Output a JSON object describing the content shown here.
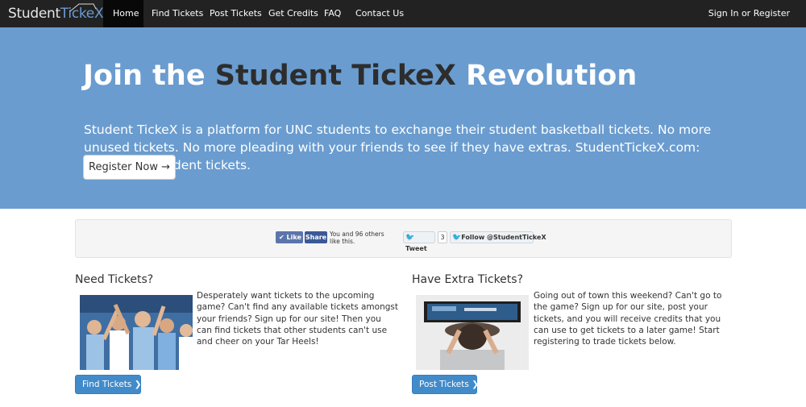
{
  "brand": {
    "part1": "Student",
    "part2": "TickeX"
  },
  "nav": {
    "home": "Home",
    "find": "Find Tickets",
    "post": "Post Tickets",
    "credits": "Get Credits",
    "faq": "FAQ",
    "contact": "Contact Us",
    "signin": "Sign In or Register"
  },
  "hero": {
    "title_part1": "Join the ",
    "title_part2": "Student TickeX",
    "title_part3": " Revolution",
    "description": "Student TickeX is a platform for UNC students to exchange their student basketball tickets. No more unused tickets. No more pleading with your friends to see if they have extras. StudentTickeX.com: Simplyfing student tickets.",
    "register_label": "Register Now →"
  },
  "social": {
    "like": "Like",
    "share": "Share",
    "like_count_text": "You and 96 others like this.",
    "tweet": "Tweet",
    "tweet_count": "3",
    "follow": "Follow @StudentTickeX"
  },
  "left": {
    "heading": "Need Tickets?",
    "text": "Desperately want tickets to the upcoming game? Can't find any available tickets amongst your friends? Sign up for our site! Then you can find tickets that other students can't use and cheer on your Tar Heels!",
    "button": "Find Tickets"
  },
  "right": {
    "heading": "Have Extra Tickets?",
    "text": "Going out of town this weekend? Can't go to the game? Sign up for our site, post your tickets, and you will receive credits that you can use to get tickets to a later game! Start registering to trade tickets below.",
    "button": "Post Tickets"
  },
  "colors": {
    "navbar": "#222222",
    "hero": "#6a9ccf",
    "primary_button": "#428bca"
  }
}
